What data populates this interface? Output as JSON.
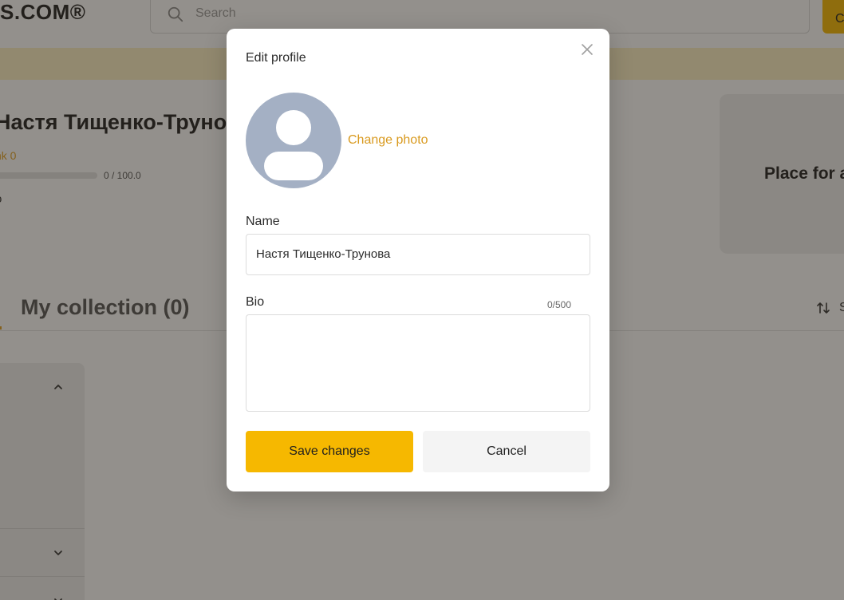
{
  "header": {
    "logo": "S.COM®",
    "search_placeholder": "Search",
    "top_button_label": "C"
  },
  "profile": {
    "name": "Настя Тищенко-Трунов",
    "rank": "nk 0",
    "progress_text": "0 / 100.0",
    "progress_fraction": 0,
    "stub": "o"
  },
  "ad": {
    "text": "Place for a"
  },
  "collection": {
    "tab_label": "My collection (0)",
    "sort_label": "S"
  },
  "modal": {
    "title": "Edit profile",
    "change_photo": "Change photo",
    "name_label": "Name",
    "name_value": "Настя Тищенко-Трунова",
    "bio_label": "Bio",
    "bio_counter": "0/500",
    "bio_value": "",
    "save_label": "Save changes",
    "cancel_label": "Cancel"
  },
  "colors": {
    "accent": "#f6b800",
    "link": "#d99a1f",
    "avatar_bg": "#a4b0c4"
  },
  "icons": [
    "search-icon",
    "close-icon",
    "avatar-placeholder-icon",
    "sort-icon",
    "chevron-up-icon",
    "chevron-down-icon"
  ]
}
